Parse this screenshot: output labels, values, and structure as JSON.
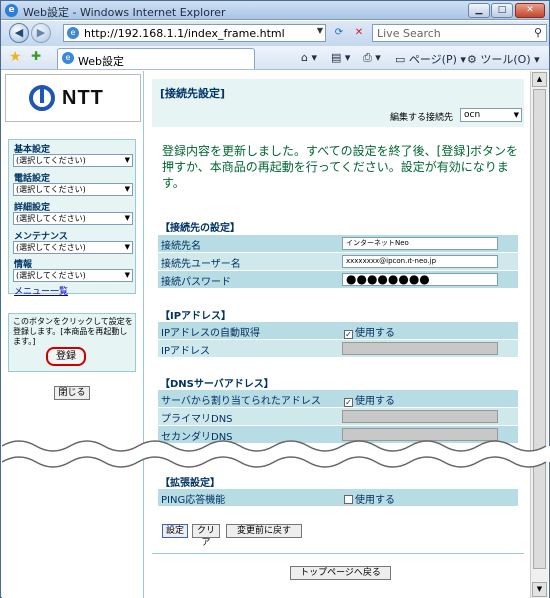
{
  "window": {
    "title": "Web設定 - Windows Internet Explorer"
  },
  "browser": {
    "url": "http://192.168.1.1/index_frame.html",
    "search_placeholder": "Live Search",
    "tab_label": "Web設定",
    "page_menu": "ページ(P)",
    "tools_menu": "ツール(O)"
  },
  "left": {
    "logo_text": "NTT",
    "menus": [
      {
        "label": "基本設定",
        "value": "(選択してください)"
      },
      {
        "label": "電話設定",
        "value": "(選択してください)"
      },
      {
        "label": "詳細設定",
        "value": "(選択してください)"
      },
      {
        "label": "メンテナンス",
        "value": "(選択してください)"
      },
      {
        "label": "情報",
        "value": "(選択してください)"
      }
    ],
    "menu_list_link": "メニュー一覧",
    "note": "このボタンをクリックして設定を登録します。[本商品を再起動します。]",
    "register_button": "登録",
    "close_button": "閉じる"
  },
  "main": {
    "title": "[接続先設定]",
    "conn_label": "編集する接続先",
    "conn_value": "ocn",
    "message": "登録内容を更新しました。すべての設定を終了後、[登録]ボタンを押すか、本商品の再起動を行ってください。設定が有効になります。",
    "sec_conn": "【接続先の設定】",
    "conn_name_label": "接続先名",
    "conn_name_value": "インターネットNeo",
    "conn_user_label": "接続先ユーザー名",
    "conn_user_value": "xxxxxxxx@ipcon.ıt-neo.jp",
    "conn_pw_label": "接続パスワード",
    "conn_pw_value": "●●●●●●●●",
    "sec_ip": "【IPアドレス】",
    "ip_auto_label": "IPアドレスの自動取得",
    "ip_auto_check": "使用する",
    "ip_label": "IPアドレス",
    "sec_dns": "【DNSサーバアドレス】",
    "dns_auto_label": "サーバから割り当てられたアドレス",
    "dns_auto_check": "使用する",
    "dns_primary_label": "プライマリDNS",
    "dns_secondary_label": "セカンダリDNS",
    "sec_ext": "【拡張設定】",
    "ping_label": "PING応答機能",
    "ping_check": "使用する",
    "btn_set": "設定",
    "btn_clear": "クリア",
    "btn_revert": "変更前に戻す",
    "btn_top": "トップページへ戻る"
  }
}
